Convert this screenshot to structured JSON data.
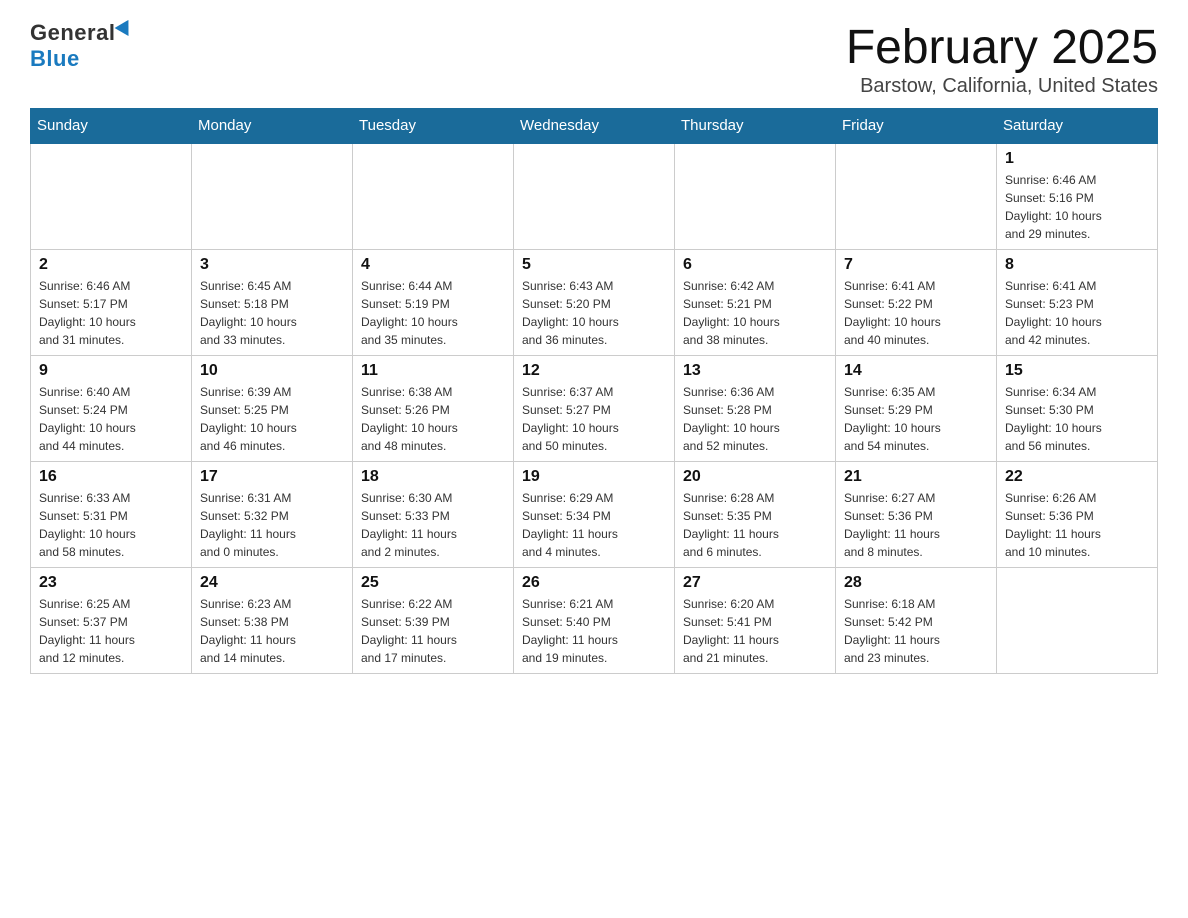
{
  "header": {
    "logo_general": "General",
    "logo_blue": "Blue",
    "month_title": "February 2025",
    "location": "Barstow, California, United States"
  },
  "days_of_week": [
    "Sunday",
    "Monday",
    "Tuesday",
    "Wednesday",
    "Thursday",
    "Friday",
    "Saturday"
  ],
  "weeks": [
    [
      {
        "day": "",
        "info": ""
      },
      {
        "day": "",
        "info": ""
      },
      {
        "day": "",
        "info": ""
      },
      {
        "day": "",
        "info": ""
      },
      {
        "day": "",
        "info": ""
      },
      {
        "day": "",
        "info": ""
      },
      {
        "day": "1",
        "info": "Sunrise: 6:46 AM\nSunset: 5:16 PM\nDaylight: 10 hours\nand 29 minutes."
      }
    ],
    [
      {
        "day": "2",
        "info": "Sunrise: 6:46 AM\nSunset: 5:17 PM\nDaylight: 10 hours\nand 31 minutes."
      },
      {
        "day": "3",
        "info": "Sunrise: 6:45 AM\nSunset: 5:18 PM\nDaylight: 10 hours\nand 33 minutes."
      },
      {
        "day": "4",
        "info": "Sunrise: 6:44 AM\nSunset: 5:19 PM\nDaylight: 10 hours\nand 35 minutes."
      },
      {
        "day": "5",
        "info": "Sunrise: 6:43 AM\nSunset: 5:20 PM\nDaylight: 10 hours\nand 36 minutes."
      },
      {
        "day": "6",
        "info": "Sunrise: 6:42 AM\nSunset: 5:21 PM\nDaylight: 10 hours\nand 38 minutes."
      },
      {
        "day": "7",
        "info": "Sunrise: 6:41 AM\nSunset: 5:22 PM\nDaylight: 10 hours\nand 40 minutes."
      },
      {
        "day": "8",
        "info": "Sunrise: 6:41 AM\nSunset: 5:23 PM\nDaylight: 10 hours\nand 42 minutes."
      }
    ],
    [
      {
        "day": "9",
        "info": "Sunrise: 6:40 AM\nSunset: 5:24 PM\nDaylight: 10 hours\nand 44 minutes."
      },
      {
        "day": "10",
        "info": "Sunrise: 6:39 AM\nSunset: 5:25 PM\nDaylight: 10 hours\nand 46 minutes."
      },
      {
        "day": "11",
        "info": "Sunrise: 6:38 AM\nSunset: 5:26 PM\nDaylight: 10 hours\nand 48 minutes."
      },
      {
        "day": "12",
        "info": "Sunrise: 6:37 AM\nSunset: 5:27 PM\nDaylight: 10 hours\nand 50 minutes."
      },
      {
        "day": "13",
        "info": "Sunrise: 6:36 AM\nSunset: 5:28 PM\nDaylight: 10 hours\nand 52 minutes."
      },
      {
        "day": "14",
        "info": "Sunrise: 6:35 AM\nSunset: 5:29 PM\nDaylight: 10 hours\nand 54 minutes."
      },
      {
        "day": "15",
        "info": "Sunrise: 6:34 AM\nSunset: 5:30 PM\nDaylight: 10 hours\nand 56 minutes."
      }
    ],
    [
      {
        "day": "16",
        "info": "Sunrise: 6:33 AM\nSunset: 5:31 PM\nDaylight: 10 hours\nand 58 minutes."
      },
      {
        "day": "17",
        "info": "Sunrise: 6:31 AM\nSunset: 5:32 PM\nDaylight: 11 hours\nand 0 minutes."
      },
      {
        "day": "18",
        "info": "Sunrise: 6:30 AM\nSunset: 5:33 PM\nDaylight: 11 hours\nand 2 minutes."
      },
      {
        "day": "19",
        "info": "Sunrise: 6:29 AM\nSunset: 5:34 PM\nDaylight: 11 hours\nand 4 minutes."
      },
      {
        "day": "20",
        "info": "Sunrise: 6:28 AM\nSunset: 5:35 PM\nDaylight: 11 hours\nand 6 minutes."
      },
      {
        "day": "21",
        "info": "Sunrise: 6:27 AM\nSunset: 5:36 PM\nDaylight: 11 hours\nand 8 minutes."
      },
      {
        "day": "22",
        "info": "Sunrise: 6:26 AM\nSunset: 5:36 PM\nDaylight: 11 hours\nand 10 minutes."
      }
    ],
    [
      {
        "day": "23",
        "info": "Sunrise: 6:25 AM\nSunset: 5:37 PM\nDaylight: 11 hours\nand 12 minutes."
      },
      {
        "day": "24",
        "info": "Sunrise: 6:23 AM\nSunset: 5:38 PM\nDaylight: 11 hours\nand 14 minutes."
      },
      {
        "day": "25",
        "info": "Sunrise: 6:22 AM\nSunset: 5:39 PM\nDaylight: 11 hours\nand 17 minutes."
      },
      {
        "day": "26",
        "info": "Sunrise: 6:21 AM\nSunset: 5:40 PM\nDaylight: 11 hours\nand 19 minutes."
      },
      {
        "day": "27",
        "info": "Sunrise: 6:20 AM\nSunset: 5:41 PM\nDaylight: 11 hours\nand 21 minutes."
      },
      {
        "day": "28",
        "info": "Sunrise: 6:18 AM\nSunset: 5:42 PM\nDaylight: 11 hours\nand 23 minutes."
      },
      {
        "day": "",
        "info": ""
      }
    ]
  ]
}
